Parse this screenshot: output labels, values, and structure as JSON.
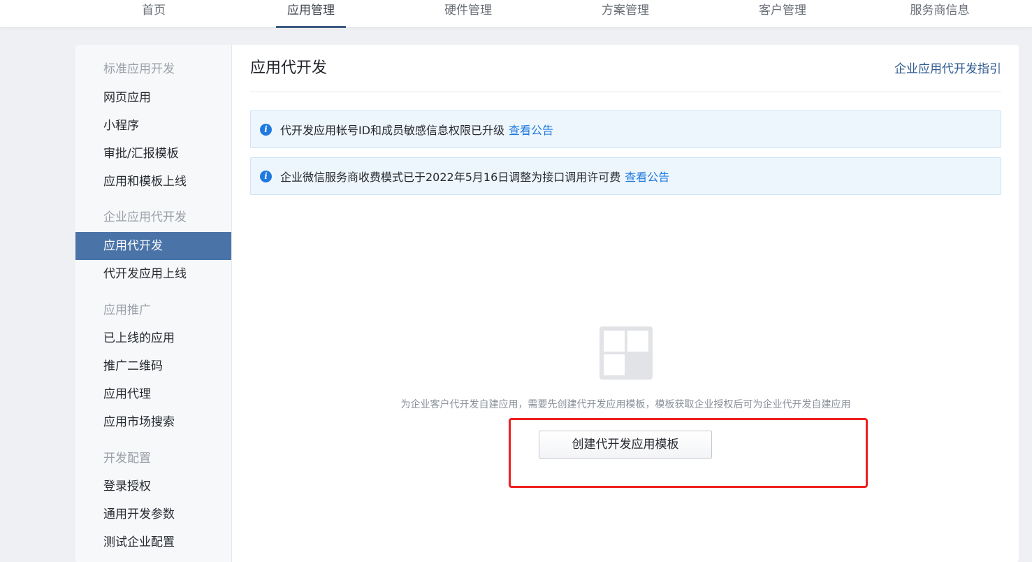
{
  "topnav": {
    "tabs": [
      {
        "label": "首页",
        "active": false
      },
      {
        "label": "应用管理",
        "active": true
      },
      {
        "label": "硬件管理",
        "active": false
      },
      {
        "label": "方案管理",
        "active": false
      },
      {
        "label": "客户管理",
        "active": false
      },
      {
        "label": "服务商信息",
        "active": false
      }
    ]
  },
  "sidebar": {
    "groups": [
      {
        "title": "标准应用开发",
        "items": [
          "网页应用",
          "小程序",
          "审批/汇报模板",
          "应用和模板上线"
        ]
      },
      {
        "title": "企业应用代开发",
        "items": [
          "应用代开发",
          "代开发应用上线"
        ]
      },
      {
        "title": "应用推广",
        "items": [
          "已上线的应用",
          "推广二维码",
          "应用代理",
          "应用市场搜索"
        ]
      },
      {
        "title": "开发配置",
        "items": [
          "登录授权",
          "通用开发参数",
          "测试企业配置"
        ]
      }
    ],
    "active_item": "应用代开发"
  },
  "main": {
    "title": "应用代开发",
    "guide_link": "企业应用代开发指引",
    "notices": [
      {
        "text": "代开发应用帐号ID和成员敏感信息权限已升级",
        "link": "查看公告"
      },
      {
        "text": "企业微信服务商收费模式已于2022年5月16日调整为接口调用许可费",
        "link": "查看公告"
      }
    ],
    "empty_state": {
      "icon": "template-grid-icon",
      "description": "为企业客户代开发自建应用，需要先创建代开发应用模板，模板获取企业授权后可为企业代开发自建应用",
      "button_label": "创建代开发应用模板"
    }
  },
  "colors": {
    "accent": "#4a73a8",
    "link": "#1f7ae0",
    "annotation": "#ee1f1f"
  }
}
